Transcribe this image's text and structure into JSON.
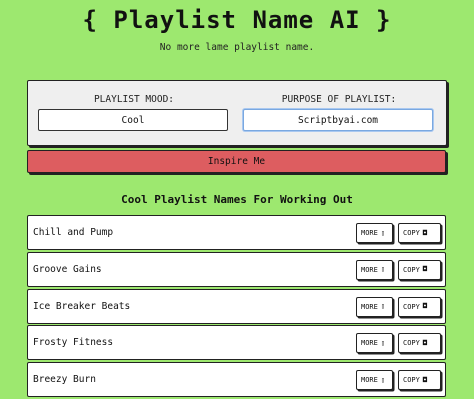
{
  "header": {
    "title": "{ Playlist Name AI }",
    "subtitle": "No more lame playlist name."
  },
  "form": {
    "mood_label": "PLAYLIST MOOD:",
    "mood_value": "Cool",
    "purpose_label": "PURPOSE OF PLAYLIST:",
    "purpose_value": "Scriptbyai.com"
  },
  "inspire_button": {
    "label": "Inspire Me",
    "color": "#dd5d60"
  },
  "results": {
    "heading": "Cool Playlist Names For Working Out",
    "more_label": "MORE",
    "more_icon": "book-icon",
    "copy_label": "COPY",
    "copy_icon": "clipboard-icon",
    "items": [
      {
        "name": "Chill and Pump"
      },
      {
        "name": "Groove Gains"
      },
      {
        "name": "Ice Breaker Beats"
      },
      {
        "name": "Frosty Fitness"
      },
      {
        "name": "Breezy Burn"
      }
    ]
  },
  "colors": {
    "background": "#9de86f",
    "panel": "#efefef",
    "focus_ring": "#7aa8e0"
  }
}
